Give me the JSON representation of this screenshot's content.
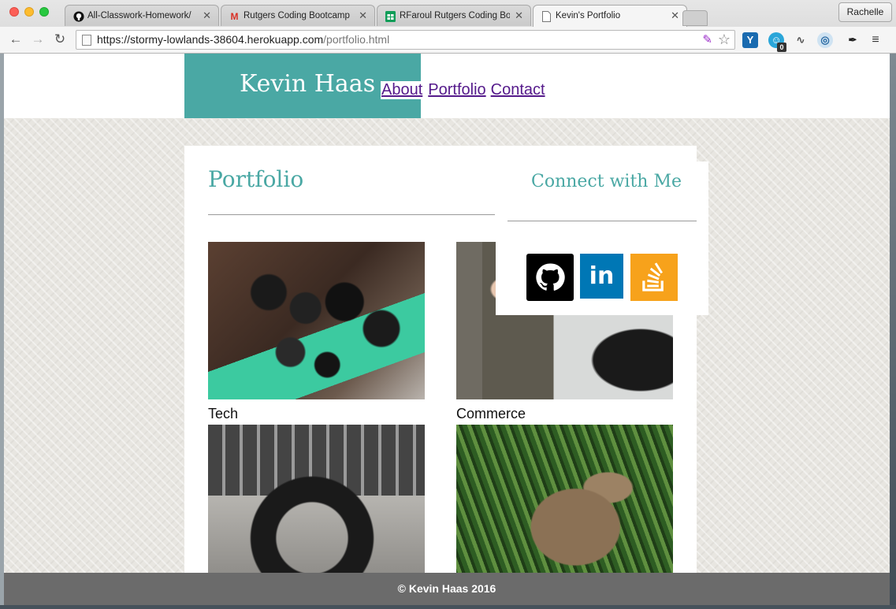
{
  "browser": {
    "tabs": [
      {
        "title": "All-Classwork-Homework/",
        "icon": "github-icon"
      },
      {
        "title": "Rutgers Coding Bootcamp",
        "icon": "gmail-icon"
      },
      {
        "title": "RFaroul Rutgers Coding Bo",
        "icon": "sheets-icon"
      },
      {
        "title": "Kevin's Portfolio",
        "icon": "page-icon",
        "active": true
      }
    ],
    "user_name": "Rachelle",
    "url_host": "https://stormy-lowlands-38604.herokuapp.com",
    "url_path": "/portfolio.html",
    "extension_badge": "0"
  },
  "site": {
    "brand": "Kevin Haas",
    "nav": {
      "about": "About",
      "portfolio": "Portfolio",
      "contact": "Contact"
    }
  },
  "portfolio": {
    "title": "Portfolio",
    "items": [
      {
        "label": "Tech"
      },
      {
        "label": "Commerce"
      },
      {
        "label": ""
      },
      {
        "label": ""
      }
    ]
  },
  "connect": {
    "title": "Connect with Me",
    "links": [
      {
        "name": "github-icon"
      },
      {
        "name": "linkedin-icon",
        "text": "in"
      },
      {
        "name": "stackoverflow-icon"
      }
    ]
  },
  "footer": {
    "text": "© Kevin Haas 2016"
  },
  "colors": {
    "accent": "#4aa8a4",
    "link_visited": "#551a8b",
    "footer_bg": "#6b6b6b"
  }
}
